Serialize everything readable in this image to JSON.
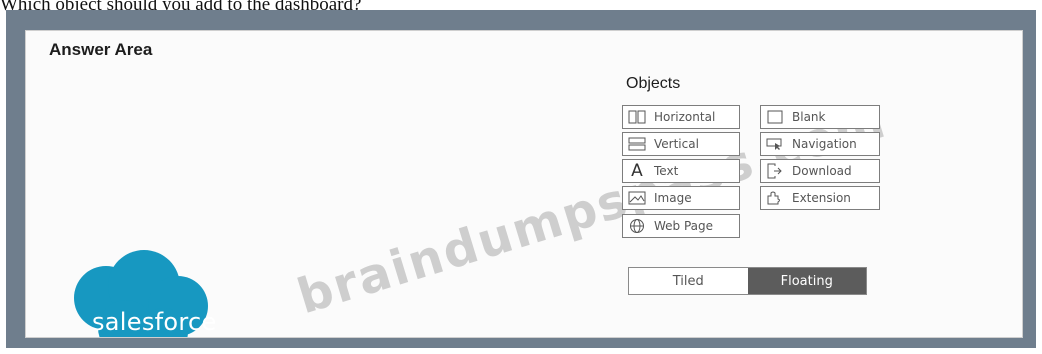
{
  "question": "Which object should you add to the dashboard?",
  "answer_area": {
    "title": "Answer Area",
    "objects_title": "Objects",
    "objects_left": [
      {
        "label": "Horizontal",
        "icon": "horizontal-container-icon"
      },
      {
        "label": "Vertical",
        "icon": "vertical-container-icon"
      },
      {
        "label": "Text",
        "icon": "text-icon"
      },
      {
        "label": "Image",
        "icon": "image-icon"
      },
      {
        "label": "Web Page",
        "icon": "globe-icon"
      }
    ],
    "objects_right": [
      {
        "label": "Blank",
        "icon": "blank-icon"
      },
      {
        "label": "Navigation",
        "icon": "navigation-icon"
      },
      {
        "label": "Download",
        "icon": "download-icon"
      },
      {
        "label": "Extension",
        "icon": "extension-icon"
      }
    ],
    "toggle": {
      "tiled": "Tiled",
      "floating": "Floating",
      "selected": "Floating"
    }
  },
  "watermark": "braindumpspass.com",
  "logo": "salesforce",
  "colors": {
    "frame": "#6f7e8d",
    "selected_toggle": "#5c5c5c",
    "logo_blue": "#1798c1"
  }
}
